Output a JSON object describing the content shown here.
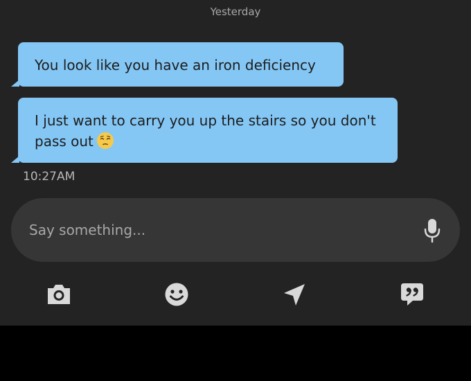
{
  "chat": {
    "date_separator": "Yesterday",
    "messages": [
      {
        "text": "You look like you have an iron deficiency"
      },
      {
        "text": "I just want to carry you up the stairs so you don't pass out",
        "emoji": "pensive-face"
      }
    ],
    "timestamp": "10:27AM"
  },
  "composer": {
    "placeholder": "Say something...",
    "mic_icon": "microphone-icon"
  },
  "toolbar": {
    "icons": [
      "camera-icon",
      "smiley-icon",
      "send-location-icon",
      "quote-icon"
    ]
  },
  "colors": {
    "background": "#232323",
    "bubble": "#84c7f5",
    "input": "#363636",
    "icon": "#d9d9d9"
  }
}
